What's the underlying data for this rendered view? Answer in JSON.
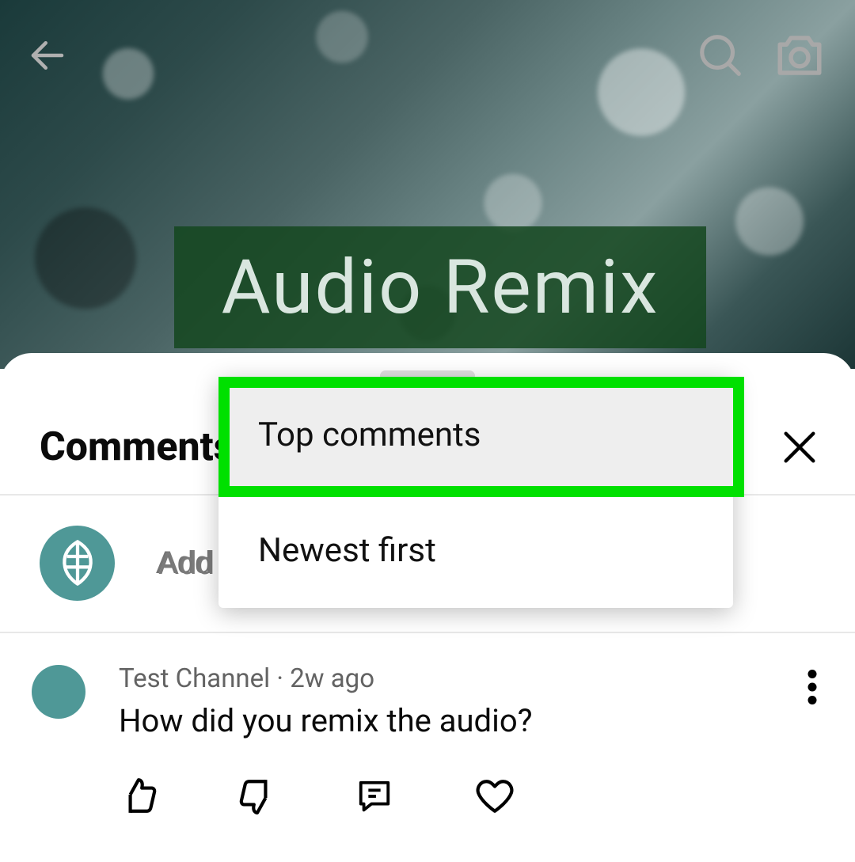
{
  "video": {
    "overlay_title": "Audio Remix"
  },
  "comments": {
    "heading": "Comments",
    "add_placeholder": "Add a comment…",
    "add_visible_text": "Add",
    "sort_options": {
      "top": "Top comments",
      "newest": "Newest first"
    },
    "items": [
      {
        "author": "Test Channel",
        "age": "2w ago",
        "separator": " · ",
        "text": "How did you remix the audio?"
      }
    ]
  }
}
